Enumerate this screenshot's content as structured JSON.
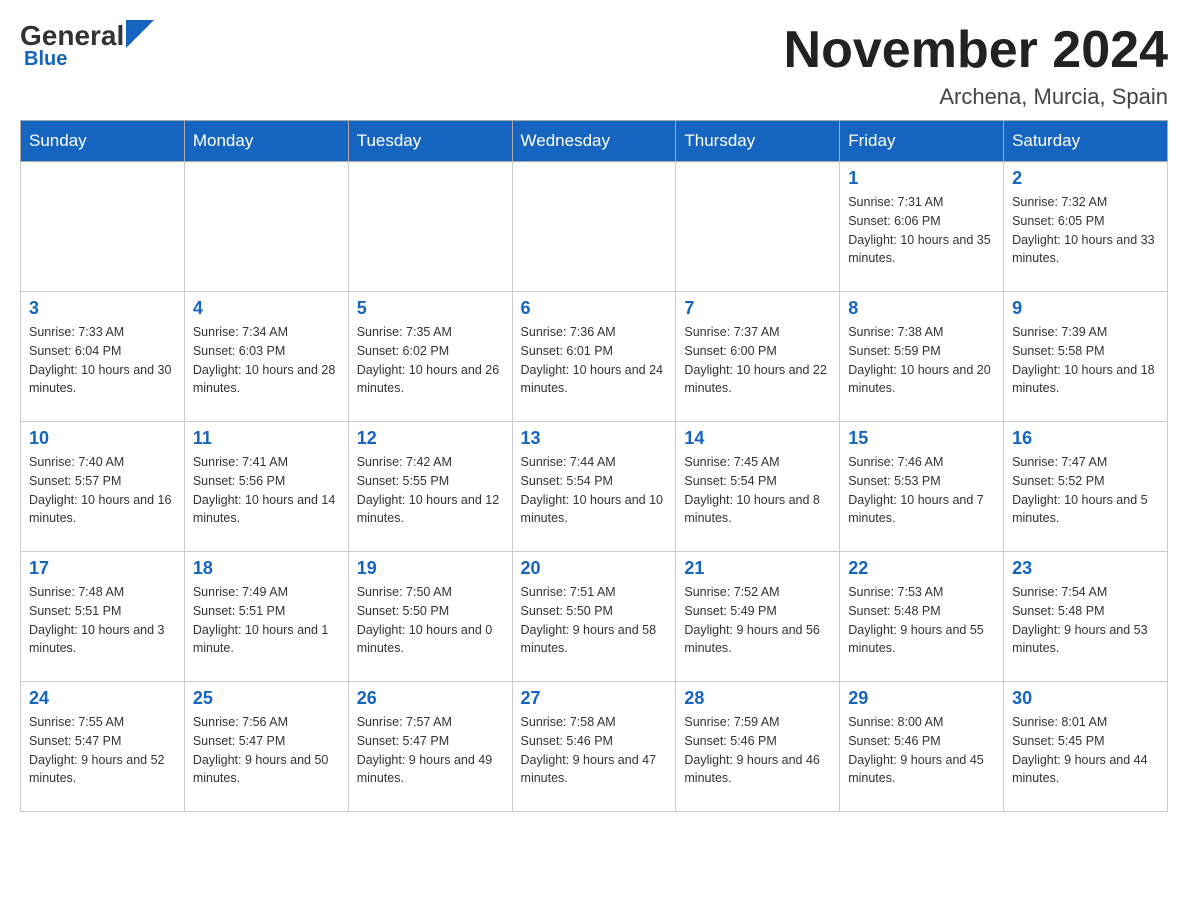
{
  "header": {
    "logo_general": "General",
    "logo_blue": "Blue",
    "month_title": "November 2024",
    "location": "Archena, Murcia, Spain"
  },
  "weekdays": [
    "Sunday",
    "Monday",
    "Tuesday",
    "Wednesday",
    "Thursday",
    "Friday",
    "Saturday"
  ],
  "weeks": [
    [
      {
        "day": "",
        "sunrise": "",
        "sunset": "",
        "daylight": ""
      },
      {
        "day": "",
        "sunrise": "",
        "sunset": "",
        "daylight": ""
      },
      {
        "day": "",
        "sunrise": "",
        "sunset": "",
        "daylight": ""
      },
      {
        "day": "",
        "sunrise": "",
        "sunset": "",
        "daylight": ""
      },
      {
        "day": "",
        "sunrise": "",
        "sunset": "",
        "daylight": ""
      },
      {
        "day": "1",
        "sunrise": "Sunrise: 7:31 AM",
        "sunset": "Sunset: 6:06 PM",
        "daylight": "Daylight: 10 hours and 35 minutes."
      },
      {
        "day": "2",
        "sunrise": "Sunrise: 7:32 AM",
        "sunset": "Sunset: 6:05 PM",
        "daylight": "Daylight: 10 hours and 33 minutes."
      }
    ],
    [
      {
        "day": "3",
        "sunrise": "Sunrise: 7:33 AM",
        "sunset": "Sunset: 6:04 PM",
        "daylight": "Daylight: 10 hours and 30 minutes."
      },
      {
        "day": "4",
        "sunrise": "Sunrise: 7:34 AM",
        "sunset": "Sunset: 6:03 PM",
        "daylight": "Daylight: 10 hours and 28 minutes."
      },
      {
        "day": "5",
        "sunrise": "Sunrise: 7:35 AM",
        "sunset": "Sunset: 6:02 PM",
        "daylight": "Daylight: 10 hours and 26 minutes."
      },
      {
        "day": "6",
        "sunrise": "Sunrise: 7:36 AM",
        "sunset": "Sunset: 6:01 PM",
        "daylight": "Daylight: 10 hours and 24 minutes."
      },
      {
        "day": "7",
        "sunrise": "Sunrise: 7:37 AM",
        "sunset": "Sunset: 6:00 PM",
        "daylight": "Daylight: 10 hours and 22 minutes."
      },
      {
        "day": "8",
        "sunrise": "Sunrise: 7:38 AM",
        "sunset": "Sunset: 5:59 PM",
        "daylight": "Daylight: 10 hours and 20 minutes."
      },
      {
        "day": "9",
        "sunrise": "Sunrise: 7:39 AM",
        "sunset": "Sunset: 5:58 PM",
        "daylight": "Daylight: 10 hours and 18 minutes."
      }
    ],
    [
      {
        "day": "10",
        "sunrise": "Sunrise: 7:40 AM",
        "sunset": "Sunset: 5:57 PM",
        "daylight": "Daylight: 10 hours and 16 minutes."
      },
      {
        "day": "11",
        "sunrise": "Sunrise: 7:41 AM",
        "sunset": "Sunset: 5:56 PM",
        "daylight": "Daylight: 10 hours and 14 minutes."
      },
      {
        "day": "12",
        "sunrise": "Sunrise: 7:42 AM",
        "sunset": "Sunset: 5:55 PM",
        "daylight": "Daylight: 10 hours and 12 minutes."
      },
      {
        "day": "13",
        "sunrise": "Sunrise: 7:44 AM",
        "sunset": "Sunset: 5:54 PM",
        "daylight": "Daylight: 10 hours and 10 minutes."
      },
      {
        "day": "14",
        "sunrise": "Sunrise: 7:45 AM",
        "sunset": "Sunset: 5:54 PM",
        "daylight": "Daylight: 10 hours and 8 minutes."
      },
      {
        "day": "15",
        "sunrise": "Sunrise: 7:46 AM",
        "sunset": "Sunset: 5:53 PM",
        "daylight": "Daylight: 10 hours and 7 minutes."
      },
      {
        "day": "16",
        "sunrise": "Sunrise: 7:47 AM",
        "sunset": "Sunset: 5:52 PM",
        "daylight": "Daylight: 10 hours and 5 minutes."
      }
    ],
    [
      {
        "day": "17",
        "sunrise": "Sunrise: 7:48 AM",
        "sunset": "Sunset: 5:51 PM",
        "daylight": "Daylight: 10 hours and 3 minutes."
      },
      {
        "day": "18",
        "sunrise": "Sunrise: 7:49 AM",
        "sunset": "Sunset: 5:51 PM",
        "daylight": "Daylight: 10 hours and 1 minute."
      },
      {
        "day": "19",
        "sunrise": "Sunrise: 7:50 AM",
        "sunset": "Sunset: 5:50 PM",
        "daylight": "Daylight: 10 hours and 0 minutes."
      },
      {
        "day": "20",
        "sunrise": "Sunrise: 7:51 AM",
        "sunset": "Sunset: 5:50 PM",
        "daylight": "Daylight: 9 hours and 58 minutes."
      },
      {
        "day": "21",
        "sunrise": "Sunrise: 7:52 AM",
        "sunset": "Sunset: 5:49 PM",
        "daylight": "Daylight: 9 hours and 56 minutes."
      },
      {
        "day": "22",
        "sunrise": "Sunrise: 7:53 AM",
        "sunset": "Sunset: 5:48 PM",
        "daylight": "Daylight: 9 hours and 55 minutes."
      },
      {
        "day": "23",
        "sunrise": "Sunrise: 7:54 AM",
        "sunset": "Sunset: 5:48 PM",
        "daylight": "Daylight: 9 hours and 53 minutes."
      }
    ],
    [
      {
        "day": "24",
        "sunrise": "Sunrise: 7:55 AM",
        "sunset": "Sunset: 5:47 PM",
        "daylight": "Daylight: 9 hours and 52 minutes."
      },
      {
        "day": "25",
        "sunrise": "Sunrise: 7:56 AM",
        "sunset": "Sunset: 5:47 PM",
        "daylight": "Daylight: 9 hours and 50 minutes."
      },
      {
        "day": "26",
        "sunrise": "Sunrise: 7:57 AM",
        "sunset": "Sunset: 5:47 PM",
        "daylight": "Daylight: 9 hours and 49 minutes."
      },
      {
        "day": "27",
        "sunrise": "Sunrise: 7:58 AM",
        "sunset": "Sunset: 5:46 PM",
        "daylight": "Daylight: 9 hours and 47 minutes."
      },
      {
        "day": "28",
        "sunrise": "Sunrise: 7:59 AM",
        "sunset": "Sunset: 5:46 PM",
        "daylight": "Daylight: 9 hours and 46 minutes."
      },
      {
        "day": "29",
        "sunrise": "Sunrise: 8:00 AM",
        "sunset": "Sunset: 5:46 PM",
        "daylight": "Daylight: 9 hours and 45 minutes."
      },
      {
        "day": "30",
        "sunrise": "Sunrise: 8:01 AM",
        "sunset": "Sunset: 5:45 PM",
        "daylight": "Daylight: 9 hours and 44 minutes."
      }
    ]
  ]
}
